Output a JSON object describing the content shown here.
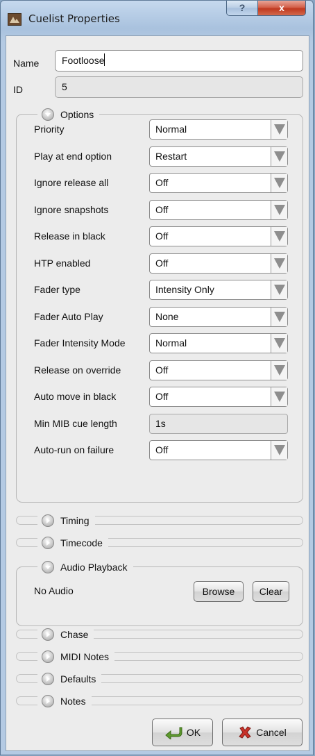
{
  "window": {
    "title": "Cuelist Properties",
    "help_label": "?",
    "close_label": "x"
  },
  "name": {
    "label": "Name",
    "value": "Footloose"
  },
  "id": {
    "label": "ID",
    "value": "5"
  },
  "options": {
    "title": "Options",
    "rows": [
      {
        "label": "Priority",
        "value": "Normal"
      },
      {
        "label": "Play at end option",
        "value": "Restart"
      },
      {
        "label": "Ignore release all",
        "value": "Off"
      },
      {
        "label": "Ignore snapshots",
        "value": "Off"
      },
      {
        "label": "Release in black",
        "value": "Off"
      },
      {
        "label": "HTP enabled",
        "value": "Off"
      },
      {
        "label": "Fader type",
        "value": "Intensity Only"
      },
      {
        "label": "Fader Auto Play",
        "value": "None"
      },
      {
        "label": "Fader Intensity Mode",
        "value": "Normal"
      },
      {
        "label": "Release on override",
        "value": "Off"
      },
      {
        "label": "Auto move in black",
        "value": "Off"
      },
      {
        "label": "Min MIB cue length",
        "value": "1s"
      },
      {
        "label": "Auto-run on failure",
        "value": "Off"
      }
    ]
  },
  "timing": {
    "title": "Timing"
  },
  "timecode": {
    "title": "Timecode"
  },
  "audio": {
    "title": "Audio Playback",
    "status": "No Audio",
    "browse_label": "Browse",
    "clear_label": "Clear"
  },
  "chase": {
    "title": "Chase"
  },
  "midi": {
    "title": "MIDI Notes"
  },
  "defaults": {
    "title": "Defaults"
  },
  "notes": {
    "title": "Notes"
  },
  "footer": {
    "ok_label": "OK",
    "cancel_label": "Cancel"
  },
  "colors": {
    "title_bar": "#b7cde6",
    "close_button": "#c0391f",
    "dialog_bg": "#ececec"
  }
}
